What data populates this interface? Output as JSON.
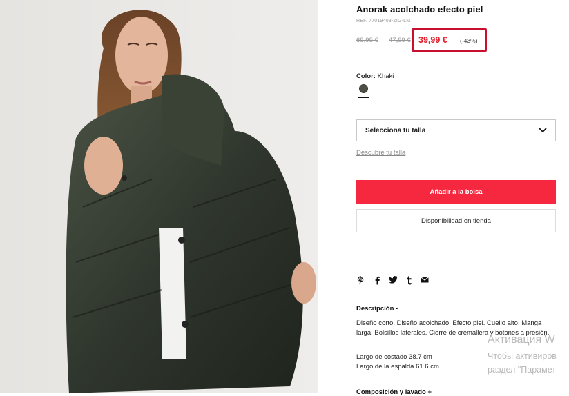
{
  "product": {
    "title": "Anorak acolchado efecto piel",
    "ref": "REF. 77019403-ZIG-LM",
    "old_price_1": "69,99 €",
    "old_price_2": "47,99 €",
    "price": "39,99 €",
    "discount": "(-43%)",
    "color_label": "Color:",
    "color_value": "Khaki",
    "swatch_color": "#4e4f45",
    "size_select_label": "Selecciona tu talla",
    "size_link": "Descubre tu talla",
    "add_to_bag": "Añadir a la bolsa",
    "store_availability": "Disponibilidad en tienda",
    "share_icons": [
      "pinterest-icon",
      "facebook-icon",
      "twitter-icon",
      "tumblr-icon",
      "email-icon"
    ]
  },
  "description": {
    "heading": "Descripción  -",
    "text": "Diseño corto. Diseño acolchado. Efecto piel. Cuello alto. Manga larga. Bolsillos laterales. Cierre de cremallera y botones a presión.",
    "measure_1": "Largo de costado 38.7 cm",
    "measure_2": "Largo de la espalda 61.6 cm",
    "composition_heading": "Composición y lavado  +"
  },
  "os_overlay": {
    "line1": "Активация W",
    "line2": "Чтобы активиров",
    "line3": "раздел \"Парамет"
  },
  "colors": {
    "accent_red": "#f62840",
    "price_red": "#e2202c",
    "highlight_box": "#c8102e"
  }
}
